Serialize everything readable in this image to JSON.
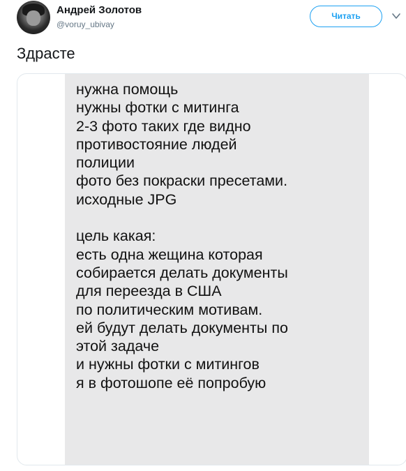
{
  "author": {
    "display_name": "Андрей Золотов",
    "handle": "@voruy_ubivay"
  },
  "follow_button_label": "Читать",
  "icons": {
    "avatar": "profile-photo",
    "menu": "chevron-down-icon"
  },
  "tweet": {
    "text": "Здрасте"
  },
  "media": {
    "lines": [
      "нужна помощь",
      "нужны фотки с митинга",
      "2-3 фото таких где видно",
      "противостояние людей",
      "полиции",
      "фото без покраски пресетами.",
      "исходные JPG",
      "",
      "цель какая:",
      "есть одна жещина которая",
      "собирается делать документы",
      "для переезда в США",
      "по политическим мотивам.",
      "ей будут делать документы по",
      "этой задаче",
      "и нужны фотки с митингов",
      "я в фотошопе её попробую"
    ]
  },
  "colors": {
    "accent": "#1da1f2",
    "text": "#14171a",
    "muted": "#657786",
    "screenshot_bg": "#e8e8e9",
    "border": "#e1e8ed"
  }
}
